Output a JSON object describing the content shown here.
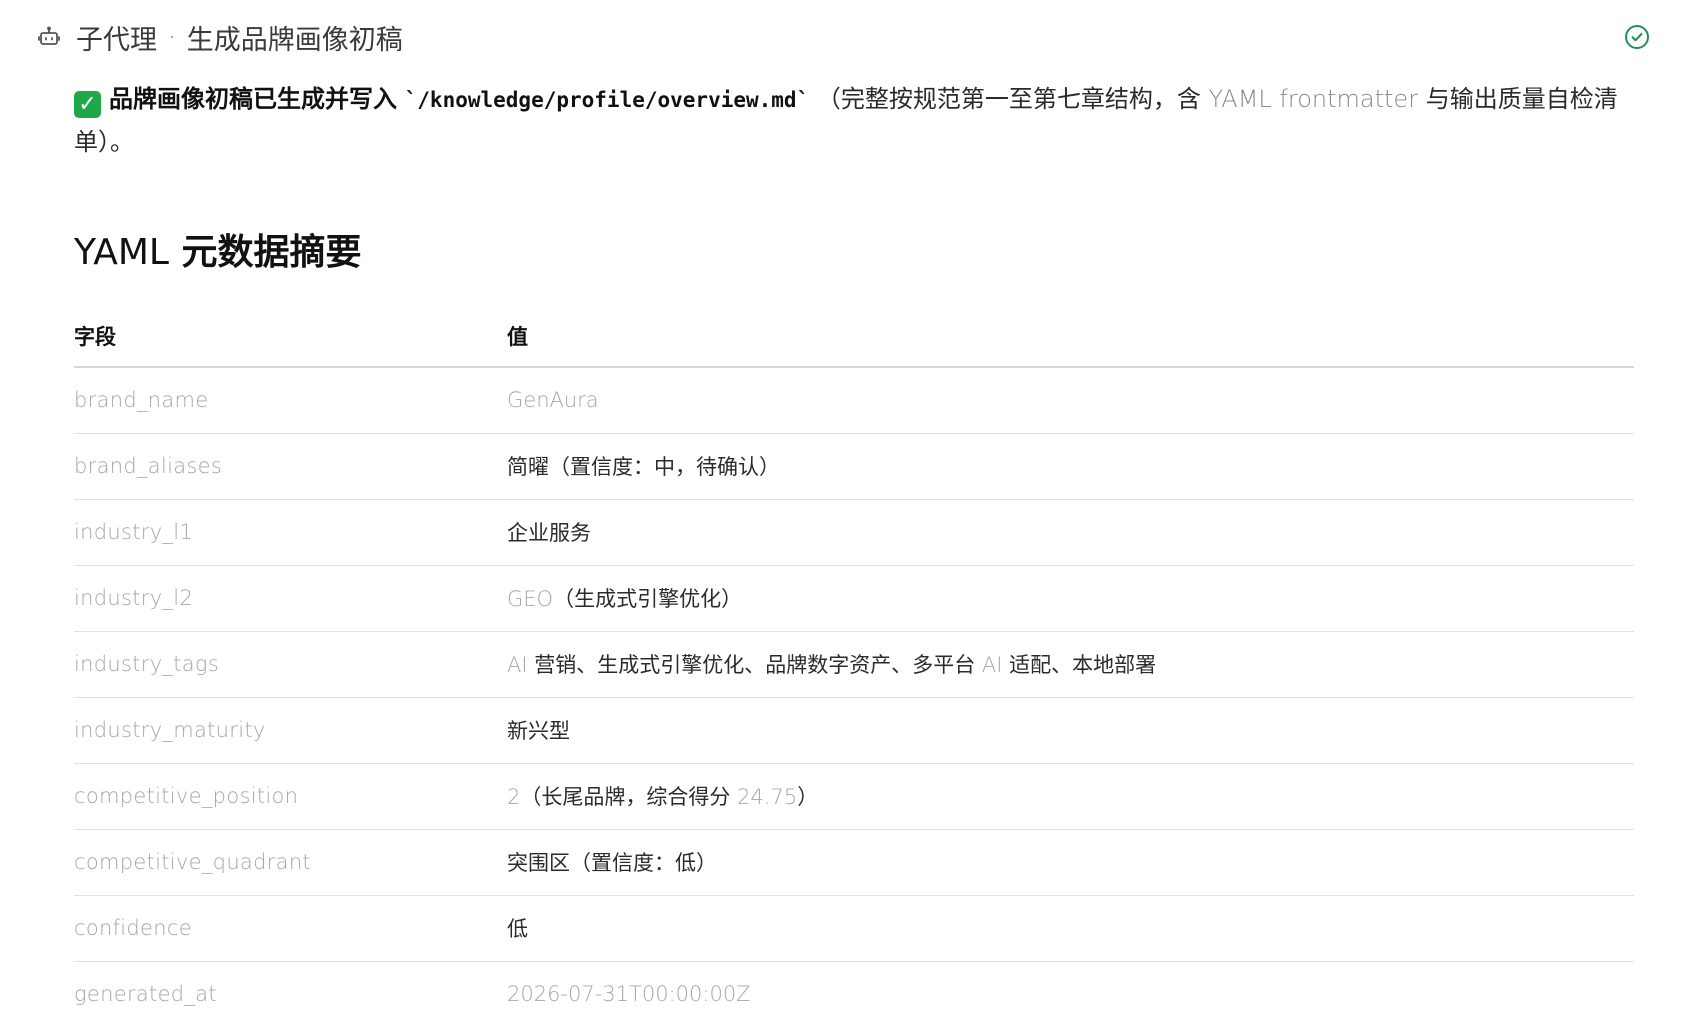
{
  "header": {
    "section_label": "子代理",
    "separator": "·",
    "title": "生成品牌画像初稿",
    "icons": {
      "agent": "robot-icon",
      "status": "check-circle-icon"
    }
  },
  "notice": {
    "emoji": "✓",
    "bold_text": "品牌画像初稿已生成并写入",
    "path": "`/knowledge/profile/overview.md`",
    "paren_open": "（完整按规范第一至第七章结构，含",
    "yaml_term": "YAML frontmatter",
    "paren_close": "与输出质量自检清单）。"
  },
  "section": {
    "title_latin": "YAML",
    "title_cn": "元数据摘要"
  },
  "table": {
    "headers": [
      "字段",
      "值"
    ],
    "rows": [
      {
        "key": "brand_name",
        "value": [
          {
            "t": "GenAura",
            "num": true
          }
        ]
      },
      {
        "key": "brand_aliases",
        "value": [
          {
            "t": "简曜（置信度：中，待确认）"
          }
        ]
      },
      {
        "key": "industry_l1",
        "value": [
          {
            "t": "企业服务"
          }
        ]
      },
      {
        "key": "industry_l2",
        "value": [
          {
            "t": "GEO",
            "num": true
          },
          {
            "t": "（生成式引擎优化）"
          }
        ]
      },
      {
        "key": "industry_tags",
        "value": [
          {
            "t": "AI",
            "num": true
          },
          {
            "t": " 营销、生成式引擎优化、品牌数字资产、多平台 "
          },
          {
            "t": "AI",
            "num": true
          },
          {
            "t": " 适配、本地部署"
          }
        ]
      },
      {
        "key": "industry_maturity",
        "value": [
          {
            "t": "新兴型"
          }
        ]
      },
      {
        "key": "competitive_position",
        "value": [
          {
            "t": "2",
            "num": true
          },
          {
            "t": "（长尾品牌，综合得分 "
          },
          {
            "t": "24.75",
            "num": true
          },
          {
            "t": "）"
          }
        ]
      },
      {
        "key": "competitive_quadrant",
        "value": [
          {
            "t": "突围区（置信度：低）"
          }
        ]
      },
      {
        "key": "confidence",
        "value": [
          {
            "t": "低"
          }
        ]
      },
      {
        "key": "generated_at",
        "value": [
          {
            "t": "2026-07-31T00:00:00Z",
            "num": true
          }
        ]
      }
    ]
  },
  "colors": {
    "accent_green": "#1fa84a",
    "muted_text": "#a6a6a6",
    "rule": "#e1e1e1"
  }
}
